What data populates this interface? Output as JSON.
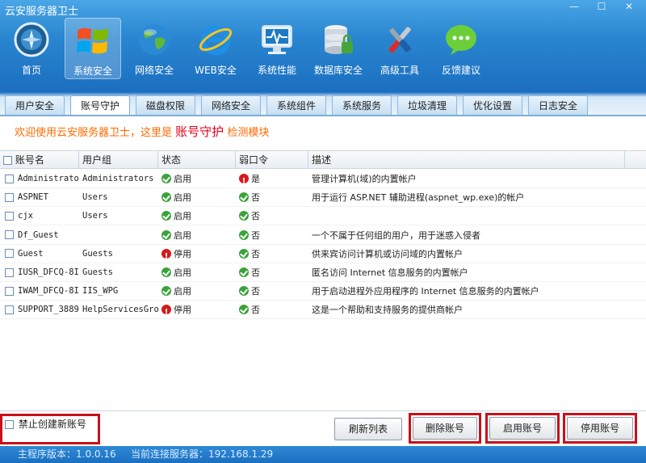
{
  "app": {
    "title": "云安服务器卫士",
    "win_min": "—",
    "win_max": "☐",
    "win_close": "✕"
  },
  "toolbar": [
    {
      "label": "首页",
      "icon": "compass-icon"
    },
    {
      "label": "系统安全",
      "icon": "windows-logo-icon"
    },
    {
      "label": "网络安全",
      "icon": "globe-icon"
    },
    {
      "label": "WEB安全",
      "icon": "ie-icon"
    },
    {
      "label": "系统性能",
      "icon": "monitor-pulse-icon"
    },
    {
      "label": "数据库安全",
      "icon": "database-lock-icon"
    },
    {
      "label": "高级工具",
      "icon": "tools-icon"
    },
    {
      "label": "反馈建议",
      "icon": "chat-bubble-icon"
    }
  ],
  "tabs": [
    "用户安全",
    "账号守护",
    "磁盘权限",
    "网络安全",
    "系统组件",
    "系统服务",
    "垃圾清理",
    "优化设置",
    "日志安全"
  ],
  "active_tab": 1,
  "welcome": {
    "prefix": "欢迎使用云安服务器卫士，这里是",
    "highlight": "账号守护",
    "suffix": "检测模块"
  },
  "table": {
    "headers": {
      "name": "账号名",
      "group": "用户组",
      "status": "状态",
      "weak": "弱口令",
      "desc": "描述"
    },
    "rows": [
      {
        "name": "Administrato",
        "group": "Administrators",
        "status": "启用",
        "status_ok": true,
        "weak": "是",
        "weak_ok": false,
        "desc": "管理计算机(域)的内置帐户"
      },
      {
        "name": "ASPNET",
        "group": "Users",
        "status": "启用",
        "status_ok": true,
        "weak": "否",
        "weak_ok": true,
        "desc": "用于运行 ASP.NET 辅助进程(aspnet_wp.exe)的帐户"
      },
      {
        "name": "cjx",
        "group": "Users",
        "status": "启用",
        "status_ok": true,
        "weak": "否",
        "weak_ok": true,
        "desc": ""
      },
      {
        "name": "Df_Guest",
        "group": "",
        "status": "启用",
        "status_ok": true,
        "weak": "否",
        "weak_ok": true,
        "desc": "一个不属于任何组的用户，用于迷惑入侵者"
      },
      {
        "name": "Guest",
        "group": "Guests",
        "status": "停用",
        "status_ok": false,
        "weak": "否",
        "weak_ok": true,
        "desc": "供来宾访问计算机或访问域的内置帐户"
      },
      {
        "name": "IUSR_DFCQ-8I!",
        "group": "Guests",
        "status": "启用",
        "status_ok": true,
        "weak": "否",
        "weak_ok": true,
        "desc": "匿名访问 Internet 信息服务的内置帐户"
      },
      {
        "name": "IWAM_DFCQ-8I!",
        "group": "IIS_WPG",
        "status": "启用",
        "status_ok": true,
        "weak": "否",
        "weak_ok": true,
        "desc": "用于启动进程外应用程序的 Internet 信息服务的内置帐户"
      },
      {
        "name": "SUPPORT_3889",
        "group": "HelpServicesGro",
        "status": "停用",
        "status_ok": false,
        "weak": "否",
        "weak_ok": true,
        "desc": "这是一个帮助和支持服务的提供商帐户"
      }
    ]
  },
  "bottom": {
    "no_create": "禁止创建新账号",
    "refresh": "刷新列表",
    "delete": "删除账号",
    "enable": "启用账号",
    "disable": "停用账号"
  },
  "status": {
    "version": "主程序版本：1.0.0.16",
    "server": "当前连接服务器：192.168.1.29"
  },
  "colors": {
    "accent": "#1b6fc0",
    "alert": "#c8101a",
    "ok": "#3aa33a",
    "welcome": "#ff6a00"
  }
}
